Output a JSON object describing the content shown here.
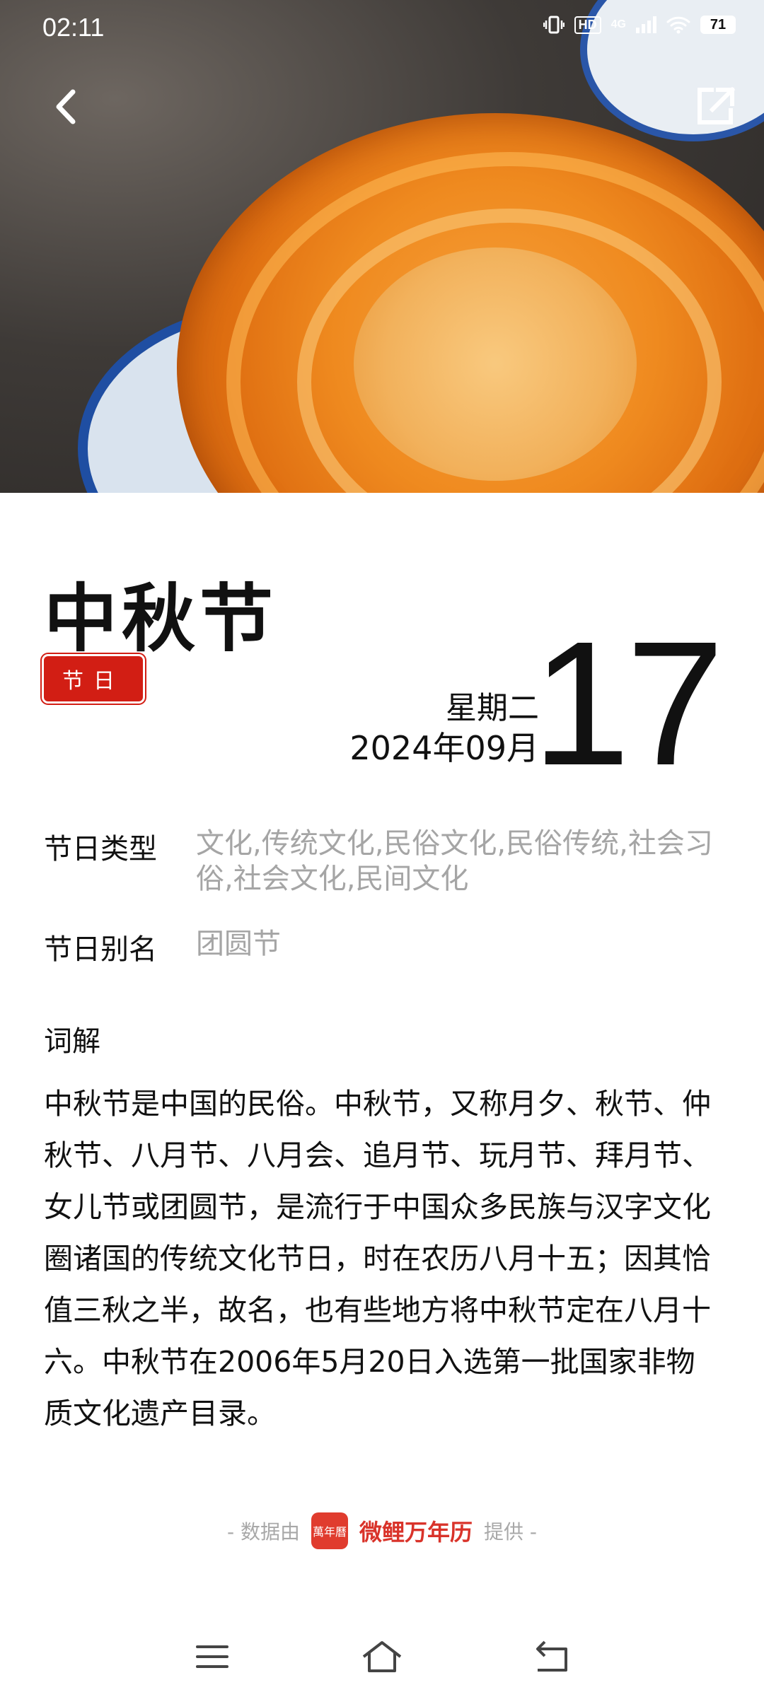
{
  "status_bar": {
    "time": "02:11",
    "hd": "HD",
    "network": "4G",
    "battery": "71"
  },
  "hero": {
    "image_icon": "mooncake-photo",
    "back_icon": "chevron-left-icon",
    "share_icon": "share-external-icon"
  },
  "festival": {
    "name": "中秋节",
    "badge": "节日",
    "weekday": "星期二",
    "year_month": "2024年09月",
    "day": "17"
  },
  "info": {
    "type_label": "节日类型",
    "type_value": "文化,传统文化,民俗文化,民俗传统,社会习俗,社会文化,民间文化",
    "alias_label": "节日别名",
    "alias_value": "团圆节"
  },
  "explanation": {
    "title": "词解",
    "text": "中秋节是中国的民俗。中秋节，又称月夕、秋节、仲秋节、八月节、八月会、追月节、玩月节、拜月节、女儿节或团圆节，是流行于中国众多民族与汉字文化圈诸国的传统文化节日，时在农历八月十五；因其恰值三秋之半，故名，也有些地方将中秋节定在八月十六。中秋节在2006年5月20日入选第一批国家非物质文化遗产目录。"
  },
  "credit": {
    "prefix": "-  数据由",
    "logo_text": "萬年曆",
    "brand": "微鲤万年历",
    "suffix": "提供  -"
  },
  "colors": {
    "accent_red": "#d21e14",
    "muted_text": "#a5a5a5"
  }
}
